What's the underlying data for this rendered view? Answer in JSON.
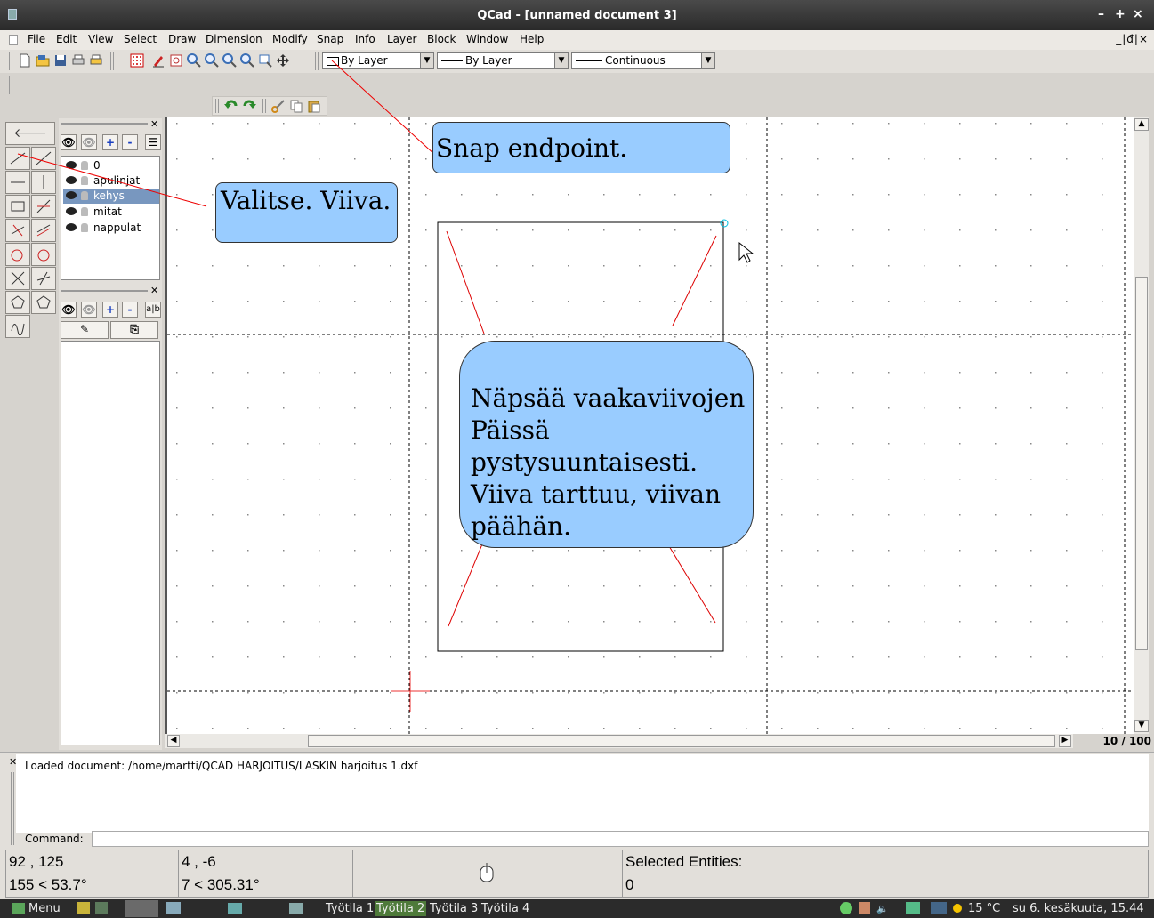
{
  "window": {
    "title": "QCad - [unnamed document 3]",
    "controls": [
      "–",
      "+",
      "×"
    ]
  },
  "menubar": {
    "items": [
      "File",
      "Edit",
      "View",
      "Select",
      "Draw",
      "Dimension",
      "Modify",
      "Snap",
      "Info",
      "Layer",
      "Block",
      "Window",
      "Help"
    ],
    "mdi_controls": "_|₫|×"
  },
  "toolbar": {
    "color_combo": "By Layer",
    "width_combo": "By Layer",
    "linetype_combo": "Continuous"
  },
  "layers": {
    "items": [
      {
        "name": "0",
        "selected": false
      },
      {
        "name": "apulinjat",
        "selected": false
      },
      {
        "name": "kehys",
        "selected": true
      },
      {
        "name": "mitat",
        "selected": false
      },
      {
        "name": "nappulat",
        "selected": false
      }
    ],
    "buttons": [
      "+",
      "-"
    ]
  },
  "blocks": {
    "buttons": [
      "+",
      "-",
      "a|b"
    ]
  },
  "annotations": {
    "snap": "Snap endpoint.",
    "select": "Valitse. Viiva.",
    "hint_lines": [
      "Näpsää vaakaviivojen",
      "Päissä pystysuuntaisesti.",
      "Viiva tarttuu, viivan",
      "päähän."
    ],
    "color": "#99ccff"
  },
  "zoom_label": "10 / 100",
  "command": {
    "log": "Loaded document: /home/martti/QCAD HARJOITUS/LASKIN harjoitus 1.dxf",
    "label": "Command:"
  },
  "status": {
    "abs_coords": "92 , 125",
    "abs_polar": "155 < 53.7°",
    "rel_coords": "4 , -6",
    "rel_polar": "7 < 305.31°",
    "selected_label": "Selected Entities:",
    "selected_count": "0"
  },
  "taskbar": {
    "menu": "Menu",
    "workspaces": [
      "Työtila 1",
      "Työtila 2",
      "Työtila 3",
      "Työtila 4"
    ],
    "active_workspace": "Työtila 2",
    "weather": "15 °C",
    "clock": "su  6. kesäkuuta, 15.44"
  }
}
